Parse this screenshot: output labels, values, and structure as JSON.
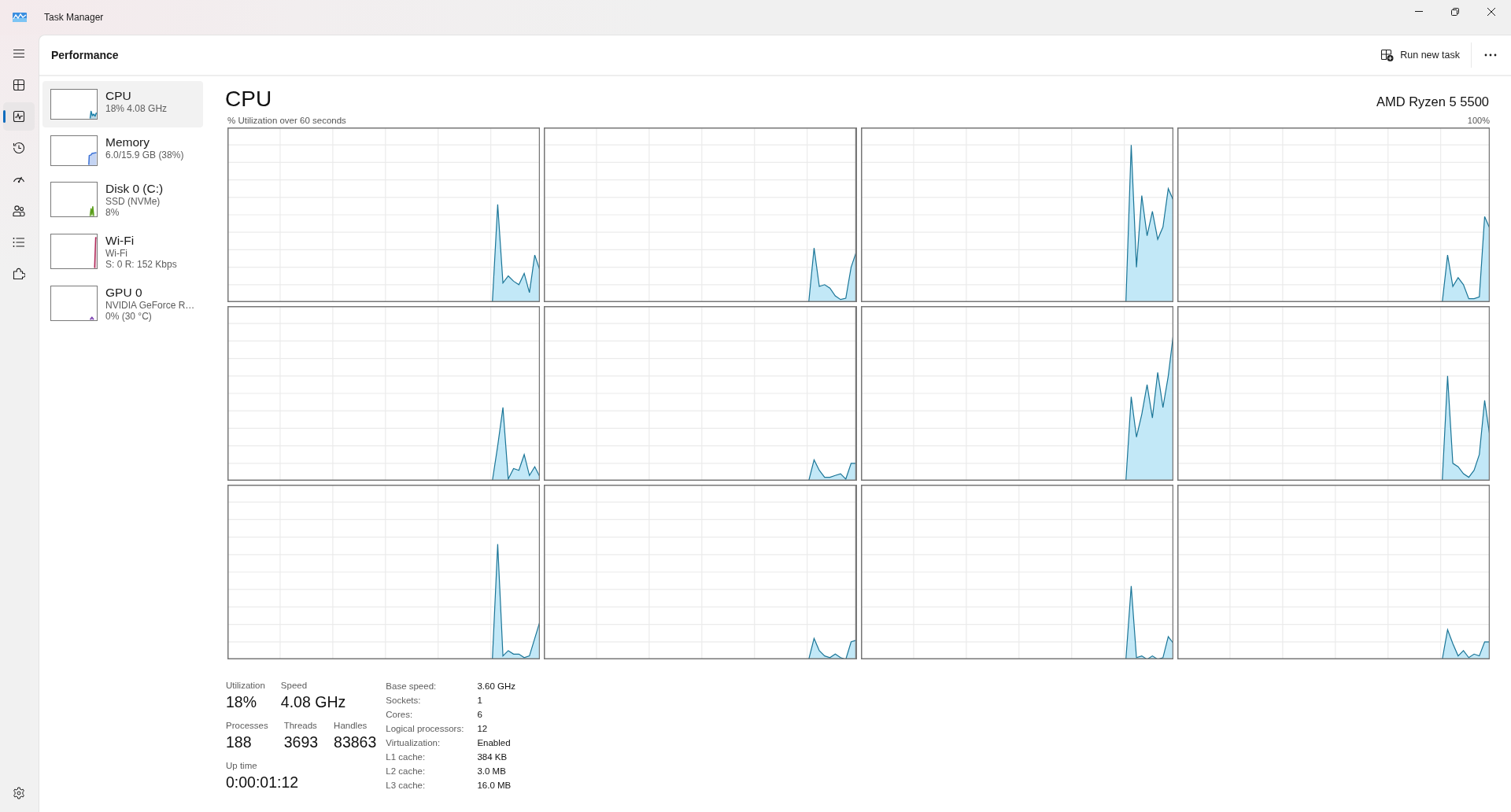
{
  "window": {
    "title": "Task Manager"
  },
  "sidebar": {
    "items": [
      {
        "selected": false
      },
      {
        "selected": true
      },
      {
        "selected": false
      },
      {
        "selected": false
      },
      {
        "selected": false
      },
      {
        "selected": false
      },
      {
        "selected": false
      }
    ]
  },
  "header": {
    "title": "Performance",
    "button": "Run new task"
  },
  "devices": [
    {
      "name": "CPU",
      "lines": [
        "18% 4.08 GHz"
      ],
      "color": "#1a7fa8",
      "selected": true
    },
    {
      "name": "Memory",
      "lines": [
        "6.0/15.9 GB (38%)"
      ],
      "color": "#3d72d6",
      "selected": false
    },
    {
      "name": "Disk 0 (C:)",
      "lines": [
        "SSD (NVMe)",
        "8%"
      ],
      "color": "#5a9e1a",
      "selected": false
    },
    {
      "name": "Wi-Fi",
      "lines": [
        "Wi-Fi",
        "S: 0 R: 152 Kbps"
      ],
      "color": "#b02a5a",
      "selected": false
    },
    {
      "name": "GPU 0",
      "lines": [
        "NVIDIA GeForce R…",
        "0% (30 °C)"
      ],
      "color": "#7a3fb0",
      "selected": false
    }
  ],
  "cpu": {
    "title": "CPU",
    "model": "AMD Ryzen 5 5500",
    "caption": "% Utilization over 60 seconds",
    "max_label": "100%"
  },
  "stats": [
    [
      {
        "label": "Utilization",
        "value": "18%"
      },
      {
        "label": "Speed",
        "value": "4.08 GHz"
      }
    ],
    [
      {
        "label": "Processes",
        "value": "188"
      },
      {
        "label": "Threads",
        "value": "3693"
      },
      {
        "label": "Handles",
        "value": "83863"
      }
    ],
    [
      {
        "label": "Up time",
        "value": "0:00:01:12"
      }
    ]
  ],
  "details": [
    {
      "label": "Base speed:",
      "value": "3.60 GHz"
    },
    {
      "label": "Sockets:",
      "value": "1"
    },
    {
      "label": "Cores:",
      "value": "6"
    },
    {
      "label": "Logical processors:",
      "value": "12"
    },
    {
      "label": "Virtualization:",
      "value": "Enabled"
    },
    {
      "label": "L1 cache:",
      "value": "384 KB"
    },
    {
      "label": "L2 cache:",
      "value": "3.0 MB"
    },
    {
      "label": "L3 cache:",
      "value": "16.0 MB"
    }
  ]
}
